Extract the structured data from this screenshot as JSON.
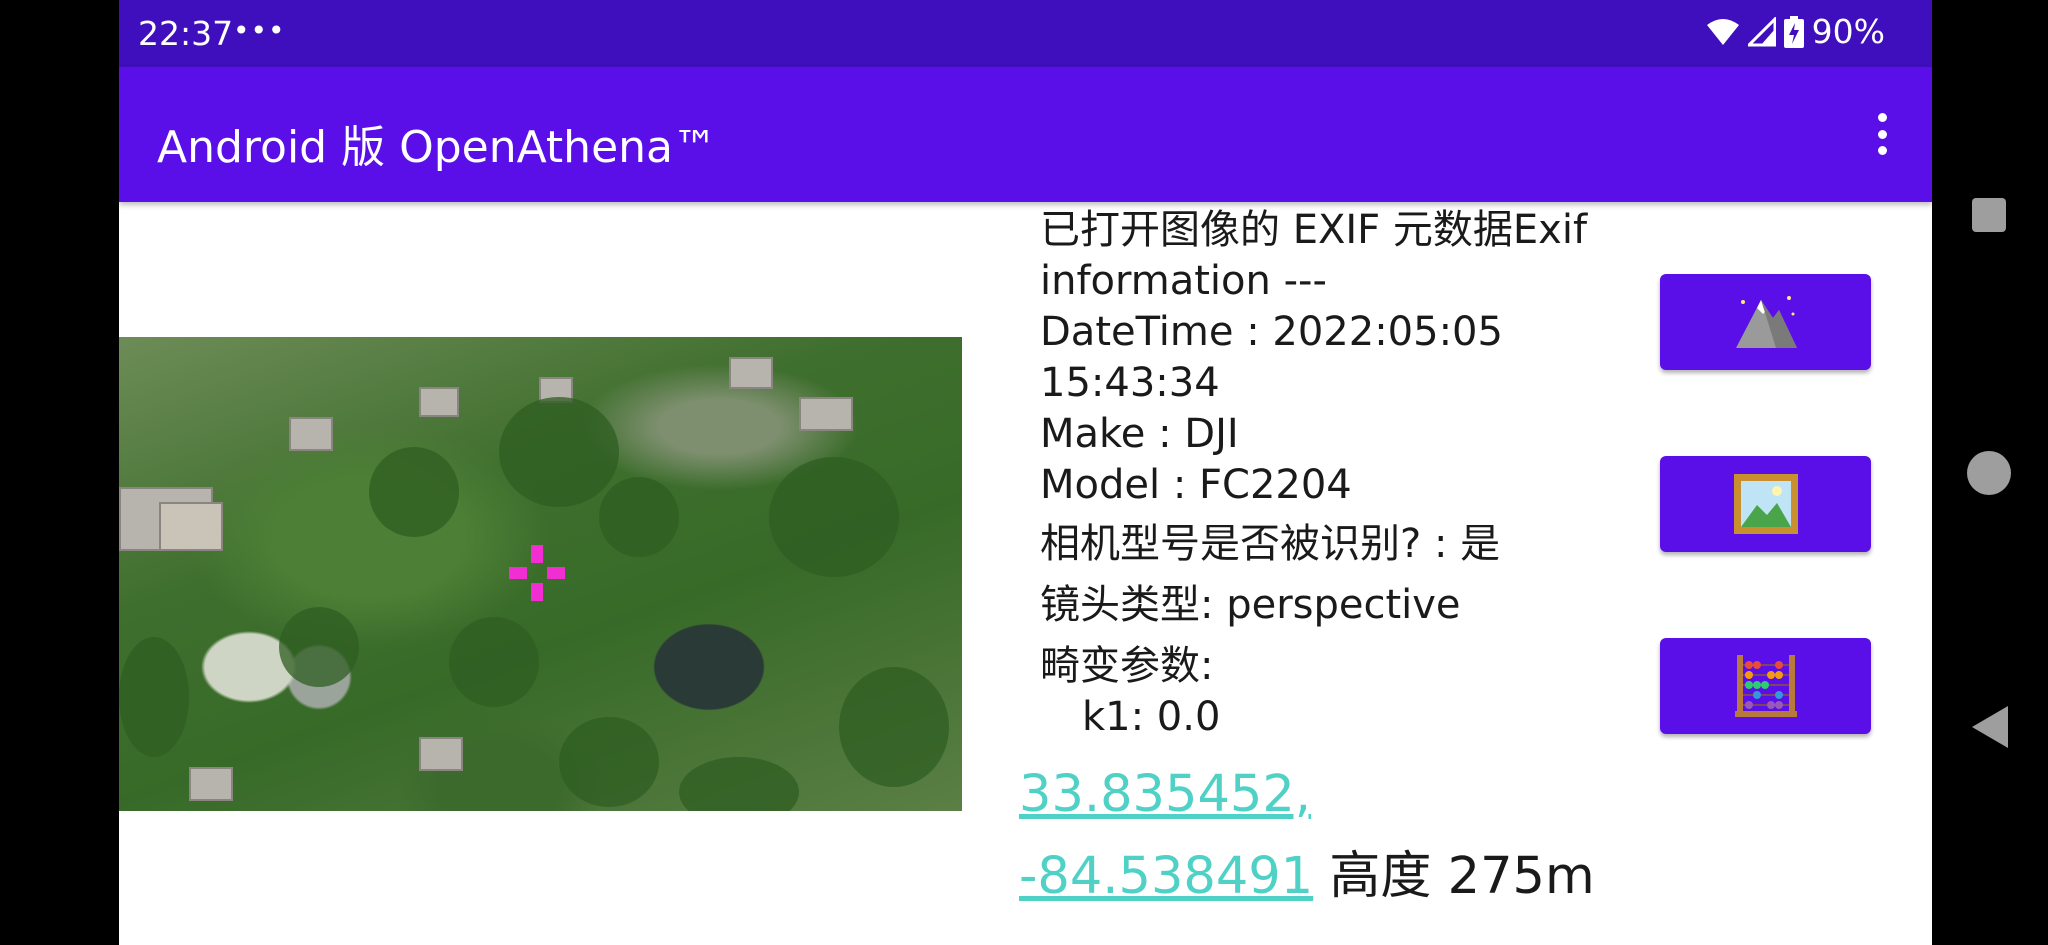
{
  "status_bar": {
    "time": "22:37",
    "notification_dots": "•••",
    "battery_percent": "90%",
    "icons": [
      "wifi-icon",
      "cell-signal-icon",
      "battery-charging-icon"
    ]
  },
  "app_bar": {
    "title": "Android 版 OpenAthena™",
    "overflow_icon": "more-vert-icon"
  },
  "exif": {
    "header": "已打开图像的 EXIF 元数据Exif information ---",
    "datetime": "DateTime : 2022:05:05 15:43:34",
    "make": "Make : DJI",
    "model": "Model : FC2204",
    "camera_recognized": "相机型号是否被识别? : 是",
    "lens_type": "镜头类型: perspective",
    "distortion_label": "畸变参数:",
    "k1": "k1: 0.0"
  },
  "result": {
    "lat": "33.835452,",
    "lon": "-84.538491",
    "altitude": "高度 275m"
  },
  "buttons": [
    {
      "icon": "mountain-icon"
    },
    {
      "icon": "framed-picture-icon"
    },
    {
      "icon": "abacus-icon"
    }
  ],
  "colors": {
    "status_bar": "#3f0fbd",
    "app_bar": "#5a0ee8",
    "link": "#4fd1c5",
    "crosshair": "#f02ed2"
  }
}
